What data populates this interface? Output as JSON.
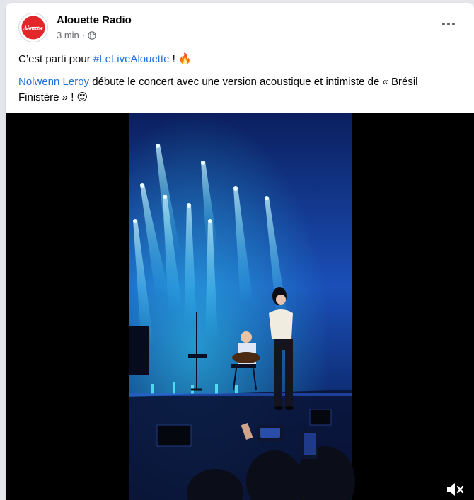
{
  "post": {
    "page_name": "Alouette Radio",
    "avatar_text": "Alouette",
    "time": "3 min",
    "separator": "·",
    "privacy_icon": "globe-icon",
    "more_icon": "more-horizontal-icon",
    "line1_prefix": "C’est parti pour ",
    "line1_hashtag": "#LeLiveAlouette",
    "line1_suffix": " ! ",
    "line1_emoji": "🔥",
    "line2_mention": "Nolwenn Leroy",
    "line2_text": " débute le concert avec une version acoustique et intimiste de « Brésil Finistère » ! ",
    "line2_emoji": "😍"
  },
  "video": {
    "mute_icon": "volume-muted-icon"
  },
  "colors": {
    "link": "#216fdb",
    "brand_red": "#e3262a",
    "stage_blue": "#1a4fb8"
  }
}
